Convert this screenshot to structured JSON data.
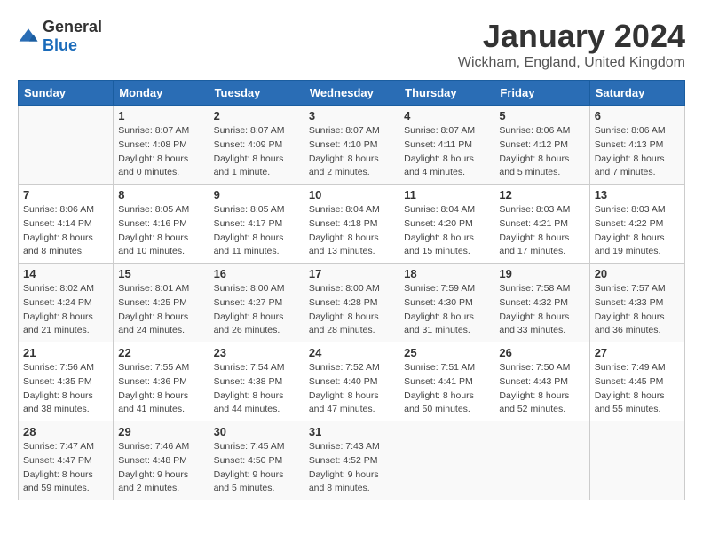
{
  "logo": {
    "text_general": "General",
    "text_blue": "Blue"
  },
  "title": "January 2024",
  "location": "Wickham, England, United Kingdom",
  "days_of_week": [
    "Sunday",
    "Monday",
    "Tuesday",
    "Wednesday",
    "Thursday",
    "Friday",
    "Saturday"
  ],
  "weeks": [
    [
      {
        "day": "",
        "sunrise": "",
        "sunset": "",
        "daylight": ""
      },
      {
        "day": "1",
        "sunrise": "Sunrise: 8:07 AM",
        "sunset": "Sunset: 4:08 PM",
        "daylight": "Daylight: 8 hours and 0 minutes."
      },
      {
        "day": "2",
        "sunrise": "Sunrise: 8:07 AM",
        "sunset": "Sunset: 4:09 PM",
        "daylight": "Daylight: 8 hours and 1 minute."
      },
      {
        "day": "3",
        "sunrise": "Sunrise: 8:07 AM",
        "sunset": "Sunset: 4:10 PM",
        "daylight": "Daylight: 8 hours and 2 minutes."
      },
      {
        "day": "4",
        "sunrise": "Sunrise: 8:07 AM",
        "sunset": "Sunset: 4:11 PM",
        "daylight": "Daylight: 8 hours and 4 minutes."
      },
      {
        "day": "5",
        "sunrise": "Sunrise: 8:06 AM",
        "sunset": "Sunset: 4:12 PM",
        "daylight": "Daylight: 8 hours and 5 minutes."
      },
      {
        "day": "6",
        "sunrise": "Sunrise: 8:06 AM",
        "sunset": "Sunset: 4:13 PM",
        "daylight": "Daylight: 8 hours and 7 minutes."
      }
    ],
    [
      {
        "day": "7",
        "sunrise": "Sunrise: 8:06 AM",
        "sunset": "Sunset: 4:14 PM",
        "daylight": "Daylight: 8 hours and 8 minutes."
      },
      {
        "day": "8",
        "sunrise": "Sunrise: 8:05 AM",
        "sunset": "Sunset: 4:16 PM",
        "daylight": "Daylight: 8 hours and 10 minutes."
      },
      {
        "day": "9",
        "sunrise": "Sunrise: 8:05 AM",
        "sunset": "Sunset: 4:17 PM",
        "daylight": "Daylight: 8 hours and 11 minutes."
      },
      {
        "day": "10",
        "sunrise": "Sunrise: 8:04 AM",
        "sunset": "Sunset: 4:18 PM",
        "daylight": "Daylight: 8 hours and 13 minutes."
      },
      {
        "day": "11",
        "sunrise": "Sunrise: 8:04 AM",
        "sunset": "Sunset: 4:20 PM",
        "daylight": "Daylight: 8 hours and 15 minutes."
      },
      {
        "day": "12",
        "sunrise": "Sunrise: 8:03 AM",
        "sunset": "Sunset: 4:21 PM",
        "daylight": "Daylight: 8 hours and 17 minutes."
      },
      {
        "day": "13",
        "sunrise": "Sunrise: 8:03 AM",
        "sunset": "Sunset: 4:22 PM",
        "daylight": "Daylight: 8 hours and 19 minutes."
      }
    ],
    [
      {
        "day": "14",
        "sunrise": "Sunrise: 8:02 AM",
        "sunset": "Sunset: 4:24 PM",
        "daylight": "Daylight: 8 hours and 21 minutes."
      },
      {
        "day": "15",
        "sunrise": "Sunrise: 8:01 AM",
        "sunset": "Sunset: 4:25 PM",
        "daylight": "Daylight: 8 hours and 24 minutes."
      },
      {
        "day": "16",
        "sunrise": "Sunrise: 8:00 AM",
        "sunset": "Sunset: 4:27 PM",
        "daylight": "Daylight: 8 hours and 26 minutes."
      },
      {
        "day": "17",
        "sunrise": "Sunrise: 8:00 AM",
        "sunset": "Sunset: 4:28 PM",
        "daylight": "Daylight: 8 hours and 28 minutes."
      },
      {
        "day": "18",
        "sunrise": "Sunrise: 7:59 AM",
        "sunset": "Sunset: 4:30 PM",
        "daylight": "Daylight: 8 hours and 31 minutes."
      },
      {
        "day": "19",
        "sunrise": "Sunrise: 7:58 AM",
        "sunset": "Sunset: 4:32 PM",
        "daylight": "Daylight: 8 hours and 33 minutes."
      },
      {
        "day": "20",
        "sunrise": "Sunrise: 7:57 AM",
        "sunset": "Sunset: 4:33 PM",
        "daylight": "Daylight: 8 hours and 36 minutes."
      }
    ],
    [
      {
        "day": "21",
        "sunrise": "Sunrise: 7:56 AM",
        "sunset": "Sunset: 4:35 PM",
        "daylight": "Daylight: 8 hours and 38 minutes."
      },
      {
        "day": "22",
        "sunrise": "Sunrise: 7:55 AM",
        "sunset": "Sunset: 4:36 PM",
        "daylight": "Daylight: 8 hours and 41 minutes."
      },
      {
        "day": "23",
        "sunrise": "Sunrise: 7:54 AM",
        "sunset": "Sunset: 4:38 PM",
        "daylight": "Daylight: 8 hours and 44 minutes."
      },
      {
        "day": "24",
        "sunrise": "Sunrise: 7:52 AM",
        "sunset": "Sunset: 4:40 PM",
        "daylight": "Daylight: 8 hours and 47 minutes."
      },
      {
        "day": "25",
        "sunrise": "Sunrise: 7:51 AM",
        "sunset": "Sunset: 4:41 PM",
        "daylight": "Daylight: 8 hours and 50 minutes."
      },
      {
        "day": "26",
        "sunrise": "Sunrise: 7:50 AM",
        "sunset": "Sunset: 4:43 PM",
        "daylight": "Daylight: 8 hours and 52 minutes."
      },
      {
        "day": "27",
        "sunrise": "Sunrise: 7:49 AM",
        "sunset": "Sunset: 4:45 PM",
        "daylight": "Daylight: 8 hours and 55 minutes."
      }
    ],
    [
      {
        "day": "28",
        "sunrise": "Sunrise: 7:47 AM",
        "sunset": "Sunset: 4:47 PM",
        "daylight": "Daylight: 8 hours and 59 minutes."
      },
      {
        "day": "29",
        "sunrise": "Sunrise: 7:46 AM",
        "sunset": "Sunset: 4:48 PM",
        "daylight": "Daylight: 9 hours and 2 minutes."
      },
      {
        "day": "30",
        "sunrise": "Sunrise: 7:45 AM",
        "sunset": "Sunset: 4:50 PM",
        "daylight": "Daylight: 9 hours and 5 minutes."
      },
      {
        "day": "31",
        "sunrise": "Sunrise: 7:43 AM",
        "sunset": "Sunset: 4:52 PM",
        "daylight": "Daylight: 9 hours and 8 minutes."
      },
      {
        "day": "",
        "sunrise": "",
        "sunset": "",
        "daylight": ""
      },
      {
        "day": "",
        "sunrise": "",
        "sunset": "",
        "daylight": ""
      },
      {
        "day": "",
        "sunrise": "",
        "sunset": "",
        "daylight": ""
      }
    ]
  ]
}
